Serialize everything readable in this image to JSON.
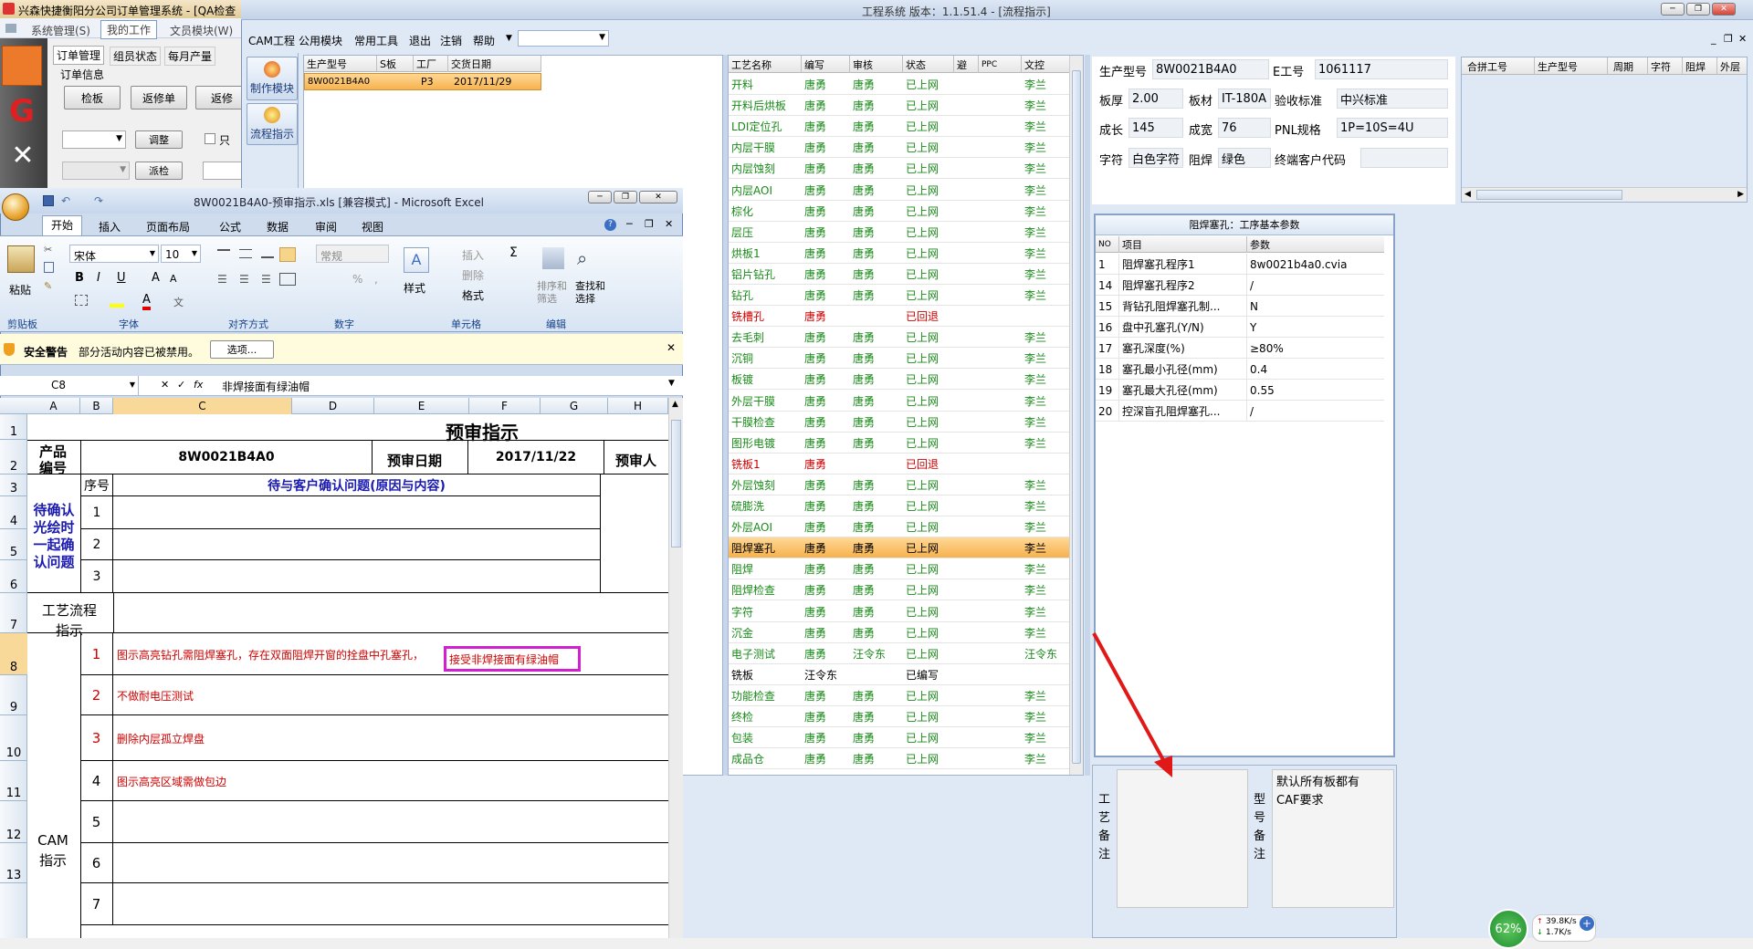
{
  "bgapp": {
    "title": "兴森快捷衡阳分公司订单管理系统 - [QA检查",
    "menu": [
      "系统管理(S)",
      "我的工作",
      "文员模块(W)"
    ],
    "tabs": [
      "订单管理",
      "组员状态",
      "每月产量"
    ],
    "group_title": "订单信息",
    "buttons": [
      "检板",
      "返修单",
      "返修",
      "调整",
      "派检"
    ],
    "checkbox_label": "只"
  },
  "main": {
    "title": "工程系统  版本：1.1.51.4 - [流程指示]",
    "menu": [
      "CAM工程",
      "公用模块",
      "常用工具",
      "退出",
      "注销",
      "帮助"
    ],
    "side_buttons": [
      "制作模块",
      "流程指示"
    ],
    "order_grid": {
      "headers": [
        "生产型号",
        "S板",
        "工厂",
        "交货日期"
      ],
      "row": [
        "8W0021B4A0",
        "",
        "P3",
        "2017/11/29"
      ]
    },
    "process_grid": {
      "headers": [
        "工艺名称",
        "编写",
        "审核",
        "状态",
        "避",
        "PPC",
        "文控"
      ],
      "rows": [
        [
          "开料",
          "唐勇",
          "唐勇",
          "已上网",
          "",
          "",
          "李兰"
        ],
        [
          "开料后烘板",
          "唐勇",
          "唐勇",
          "已上网",
          "",
          "",
          "李兰"
        ],
        [
          "LDI定位孔",
          "唐勇",
          "唐勇",
          "已上网",
          "",
          "",
          "李兰"
        ],
        [
          "内层干膜",
          "唐勇",
          "唐勇",
          "已上网",
          "",
          "",
          "李兰"
        ],
        [
          "内层蚀刻",
          "唐勇",
          "唐勇",
          "已上网",
          "",
          "",
          "李兰"
        ],
        [
          "内层AOI",
          "唐勇",
          "唐勇",
          "已上网",
          "",
          "",
          "李兰"
        ],
        [
          "棕化",
          "唐勇",
          "唐勇",
          "已上网",
          "",
          "",
          "李兰"
        ],
        [
          "层压",
          "唐勇",
          "唐勇",
          "已上网",
          "",
          "",
          "李兰"
        ],
        [
          "烘板1",
          "唐勇",
          "唐勇",
          "已上网",
          "",
          "",
          "李兰"
        ],
        [
          "铝片钻孔",
          "唐勇",
          "唐勇",
          "已上网",
          "",
          "",
          "李兰"
        ],
        [
          "钻孔",
          "唐勇",
          "唐勇",
          "已上网",
          "",
          "",
          "李兰"
        ],
        [
          "铣槽孔",
          "唐勇",
          "",
          "已回退",
          "",
          "",
          ""
        ],
        [
          "去毛刺",
          "唐勇",
          "唐勇",
          "已上网",
          "",
          "",
          "李兰"
        ],
        [
          "沉铜",
          "唐勇",
          "唐勇",
          "已上网",
          "",
          "",
          "李兰"
        ],
        [
          "板镀",
          "唐勇",
          "唐勇",
          "已上网",
          "",
          "",
          "李兰"
        ],
        [
          "外层干膜",
          "唐勇",
          "唐勇",
          "已上网",
          "",
          "",
          "李兰"
        ],
        [
          "干膜检查",
          "唐勇",
          "唐勇",
          "已上网",
          "",
          "",
          "李兰"
        ],
        [
          "图形电镀",
          "唐勇",
          "唐勇",
          "已上网",
          "",
          "",
          "李兰"
        ],
        [
          "铣板1",
          "唐勇",
          "",
          "已回退",
          "",
          "",
          ""
        ],
        [
          "外层蚀刻",
          "唐勇",
          "唐勇",
          "已上网",
          "",
          "",
          "李兰"
        ],
        [
          "硫膨洗",
          "唐勇",
          "唐勇",
          "已上网",
          "",
          "",
          "李兰"
        ],
        [
          "外层AOI",
          "唐勇",
          "唐勇",
          "已上网",
          "",
          "",
          "李兰"
        ],
        [
          "阻焊塞孔",
          "唐勇",
          "唐勇",
          "已上网",
          "",
          "",
          "李兰"
        ],
        [
          "阻焊",
          "唐勇",
          "唐勇",
          "已上网",
          "",
          "",
          "李兰"
        ],
        [
          "阻焊检查",
          "唐勇",
          "唐勇",
          "已上网",
          "",
          "",
          "李兰"
        ],
        [
          "字符",
          "唐勇",
          "唐勇",
          "已上网",
          "",
          "",
          "李兰"
        ],
        [
          "沉金",
          "唐勇",
          "唐勇",
          "已上网",
          "",
          "",
          "李兰"
        ],
        [
          "电子测试",
          "唐勇",
          "汪令东",
          "已上网",
          "",
          "",
          "汪令东"
        ],
        [
          "铣板",
          "汪令东",
          "",
          "已编写",
          "",
          "",
          ""
        ],
        [
          "功能检查",
          "唐勇",
          "唐勇",
          "已上网",
          "",
          "",
          "李兰"
        ],
        [
          "终检",
          "唐勇",
          "唐勇",
          "已上网",
          "",
          "",
          "李兰"
        ],
        [
          "包装",
          "唐勇",
          "唐勇",
          "已上网",
          "",
          "",
          "李兰"
        ],
        [
          "成品仓",
          "唐勇",
          "唐勇",
          "已上网",
          "",
          "",
          "李兰"
        ]
      ],
      "selected_index": 22
    },
    "info": {
      "prod_model_label": "生产型号",
      "prod_model": "8W0021B4A0",
      "e_no_label": "E工号",
      "e_no": "1061117",
      "thickness_label": "板厚",
      "thickness": "2.00",
      "material_label": "板材",
      "material": "IT-180A",
      "std_label": "验收标准",
      "std": "中兴标准",
      "len_label": "成长",
      "len": "145",
      "width_label": "成宽",
      "width": "76",
      "pnl_label": "PNL规格",
      "pnl": "1P=10S=4U",
      "char_label": "字符",
      "char": "白色字符",
      "mask_label": "阻焊",
      "mask": "绿色",
      "cust_label": "终端客户代码",
      "cust": ""
    },
    "merge_grid_headers": [
      "合拼工号",
      "生产型号",
      "周期",
      "字符",
      "阻焊",
      "外层"
    ],
    "params": {
      "title": "阻焊塞孔：工序基本参数",
      "headers": [
        "NO",
        "项目",
        "参数"
      ],
      "rows": [
        [
          "1",
          "阻焊塞孔程序1",
          "8w0021b4a0.cvia"
        ],
        [
          "14",
          "阻焊塞孔程序2",
          "/"
        ],
        [
          "15",
          "背钻孔阻焊塞孔制...",
          "N"
        ],
        [
          "16",
          "盘中孔塞孔(Y/N)",
          "Y"
        ],
        [
          "17",
          "塞孔深度(%)",
          "≥80%"
        ],
        [
          "18",
          "塞孔最小孔径(mm)",
          "0.4"
        ],
        [
          "19",
          "塞孔最大孔径(mm)",
          "0.55"
        ],
        [
          "20",
          "控深盲孔阻焊塞孔...",
          "/"
        ]
      ]
    },
    "process_note_label": "工艺备注",
    "model_note_label": "型号备注",
    "model_note_text": "默认所有板都有CAF要求"
  },
  "excel": {
    "title": "8W0021B4A0-预审指示.xls  [兼容模式] - Microsoft Excel",
    "ribbon_tabs": [
      "开始",
      "插入",
      "页面布局",
      "公式",
      "数据",
      "审阅",
      "视图"
    ],
    "font_name": "宋体",
    "font_size": "10",
    "number_format": "常规",
    "groups": [
      "剪贴板",
      "字体",
      "对齐方式",
      "数字",
      "单元格",
      "编辑"
    ],
    "paste_label": "粘贴",
    "style_label": "样式",
    "cells_buttons": [
      "插入",
      "删除",
      "格式"
    ],
    "edit_buttons": [
      "排序和筛选",
      "查找和选择"
    ],
    "security_label": "安全警告",
    "security_text": "部分活动内容已被禁用。",
    "options_button": "选项...",
    "name_box": "C8",
    "formula": "非焊接面有绿油帽",
    "col_headers": [
      "A",
      "B",
      "C",
      "D",
      "E",
      "F",
      "G",
      "H"
    ],
    "row_numbers": [
      "1",
      "2",
      "3",
      "4",
      "5",
      "6",
      "7",
      "8",
      "9",
      "10",
      "11",
      "12",
      "13"
    ],
    "sheet": {
      "title": "预审指示",
      "product_no_label": "产品编号",
      "product_no": "8W0021B4A0",
      "review_date_label": "预审日期",
      "review_date": "2017/11/22",
      "reviewer_label": "预审人",
      "seq_label": "序号",
      "issues_header": "待与客户确认问题(原因与内容)",
      "confirm_label": "待确认光绘时一起确认问题",
      "flow_label": "工艺流程指示",
      "cam_label": "CAM指示",
      "confirm_nums": [
        "1",
        "2",
        "3"
      ],
      "cam_nums": [
        "1",
        "2",
        "3",
        "4",
        "5",
        "6",
        "7"
      ],
      "cam_items": [
        "图示高亮钻孔需阻焊塞孔，存在双面阻焊开窗的拴盘中孔塞孔，",
        "不做耐电压测试",
        "删除内层孤立焊盘",
        "图示高亮区域需做包边"
      ],
      "c8_edit": "接受非焊接面有绿油帽"
    }
  },
  "tray": {
    "percent": "62%",
    "up": "39.8K/s",
    "down": "1.7K/s"
  }
}
